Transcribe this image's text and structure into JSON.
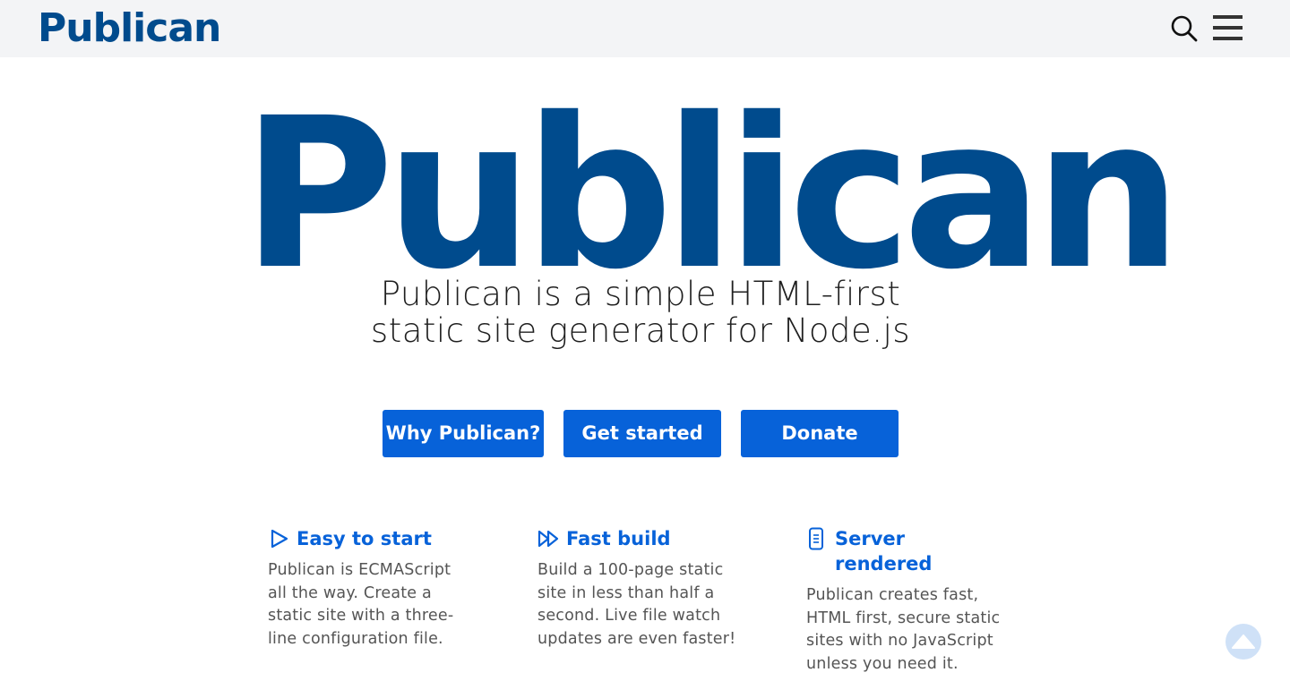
{
  "header": {
    "logo": "Publican",
    "search_icon": "search-icon",
    "menu_icon": "hamburger-menu-icon"
  },
  "hero": {
    "logo": "Publican",
    "tagline_line1": "Publican is a simple HTML-first",
    "tagline_line2": "static site generator for Node.js"
  },
  "buttons": {
    "why": "Why Publican?",
    "get_started": "Get started",
    "donate": "Donate"
  },
  "features": [
    {
      "icon": "play-icon",
      "title": "Easy to start",
      "description": "Publican is ECMAScript all the way. Create a static site with a three-line configuration file."
    },
    {
      "icon": "fast-forward-icon",
      "title": "Fast build",
      "description": "Build a 100-page static site in less than half a second. Live file watch updates are even faster!"
    },
    {
      "icon": "mobile-phone-icon",
      "title": "Server rendered",
      "description": "Publican creates fast, HTML first, secure static sites with no JavaScript unless you need it."
    }
  ],
  "colors": {
    "brand": "#004b8d",
    "accent": "#0762d9",
    "header_bg": "#f3f4f6"
  },
  "scroll_top_icon": "scroll-to-top-icon"
}
